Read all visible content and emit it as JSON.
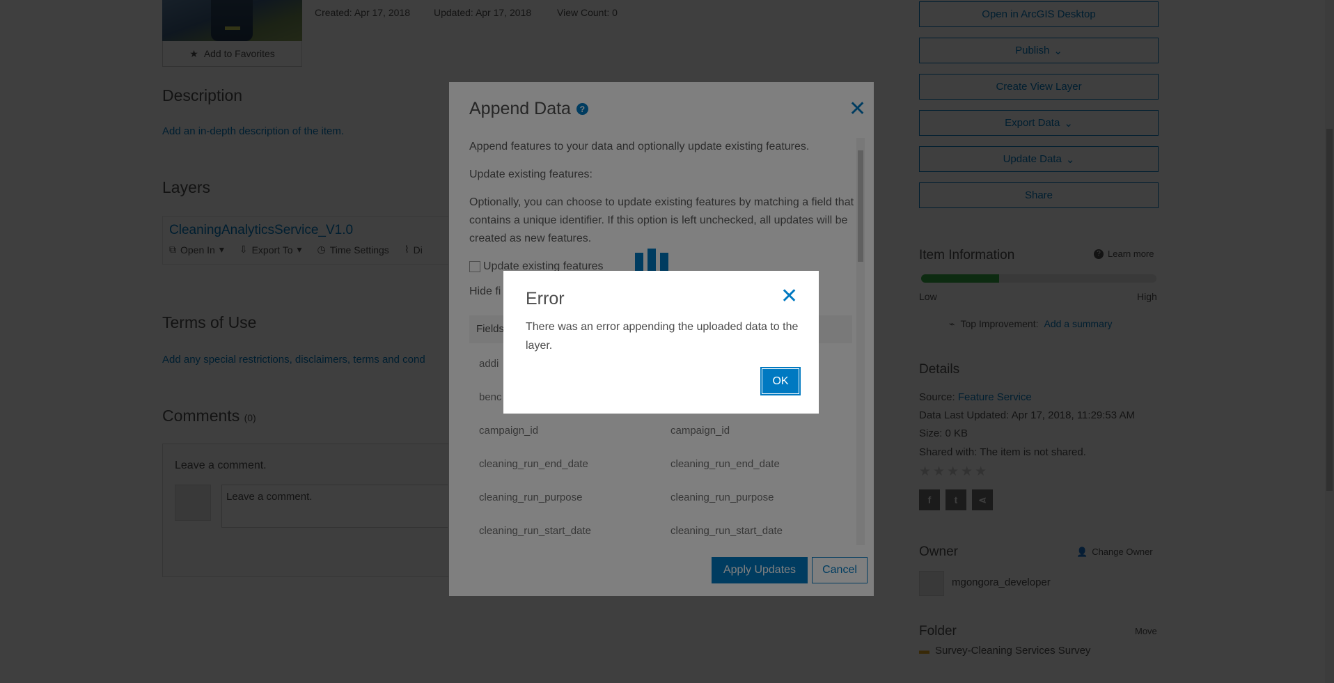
{
  "item": {
    "add_to_favorites": "Add to Favorites",
    "created": "Created: Apr 17, 2018",
    "updated": "Updated: Apr 17, 2018",
    "view_count": "View Count: 0"
  },
  "description": {
    "heading": "Description",
    "link": "Add an in-depth description of the item."
  },
  "layers": {
    "heading": "Layers",
    "name": "CleaningAnalyticsService_V1.0",
    "tools": [
      "Open In",
      "Export To",
      "Time Settings",
      "Di"
    ]
  },
  "terms": {
    "heading": "Terms of Use",
    "link": "Add any special restrictions, disclaimers, terms and cond"
  },
  "comments": {
    "heading": "Comments",
    "count": "(0)",
    "prompt": "Leave a comment.",
    "placeholder": "Leave a comment."
  },
  "actions": {
    "open_desktop": "Open in ArcGIS Desktop",
    "publish": "Publish",
    "create_view": "Create View Layer",
    "export_data": "Export Data",
    "update_data": "Update Data",
    "share": "Share"
  },
  "item_info": {
    "heading": "Item Information",
    "learn_more": "Learn more",
    "progress_fraction": 0.33,
    "low": "Low",
    "high": "High",
    "top_improvement": "Top Improvement:",
    "add_summary": "Add a summary"
  },
  "details": {
    "heading": "Details",
    "source_label": "Source:",
    "source_value": "Feature Service",
    "last_updated": "Data Last Updated: Apr 17, 2018, 11:29:53 AM",
    "size": "Size: 0 KB",
    "shared_with_label": "Shared with:",
    "shared_with_value": "The item is not shared.",
    "stars": "★★★★★",
    "rating": 0
  },
  "owner": {
    "heading": "Owner",
    "change_owner": "Change Owner",
    "name": "mgongora_developer"
  },
  "folder": {
    "heading": "Folder",
    "move": "Move",
    "name": "Survey-Cleaning Services Survey"
  },
  "append_modal": {
    "title": "Append Data",
    "intro": "Append features to your data and optionally update existing features.",
    "update_heading": "Update existing features:",
    "update_text": "Optionally, you can choose to update existing features by matching a field that contains a unique identifier. If this option is left unchecked, all updates will be created as new features.",
    "checkbox_label": "Update existing features",
    "hide_link": "Hide fi",
    "field_header": "Fields",
    "rows": [
      {
        "left": "addi",
        "right": ""
      },
      {
        "left": "benc",
        "right": ""
      },
      {
        "left": "campaign_id",
        "right": "campaign_id"
      },
      {
        "left": "cleaning_run_end_date",
        "right": "cleaning_run_end_date"
      },
      {
        "left": "cleaning_run_purpose",
        "right": "cleaning_run_purpose"
      },
      {
        "left": "cleaning_run_start_date",
        "right": "cleaning_run_start_date"
      }
    ],
    "apply": "Apply Updates",
    "cancel": "Cancel"
  },
  "error_dialog": {
    "title": "Error",
    "message": "There was an error appending the uploaded data to the layer.",
    "ok": "OK"
  },
  "colors": {
    "accent": "#0079c1",
    "progress": "#35ac46"
  }
}
